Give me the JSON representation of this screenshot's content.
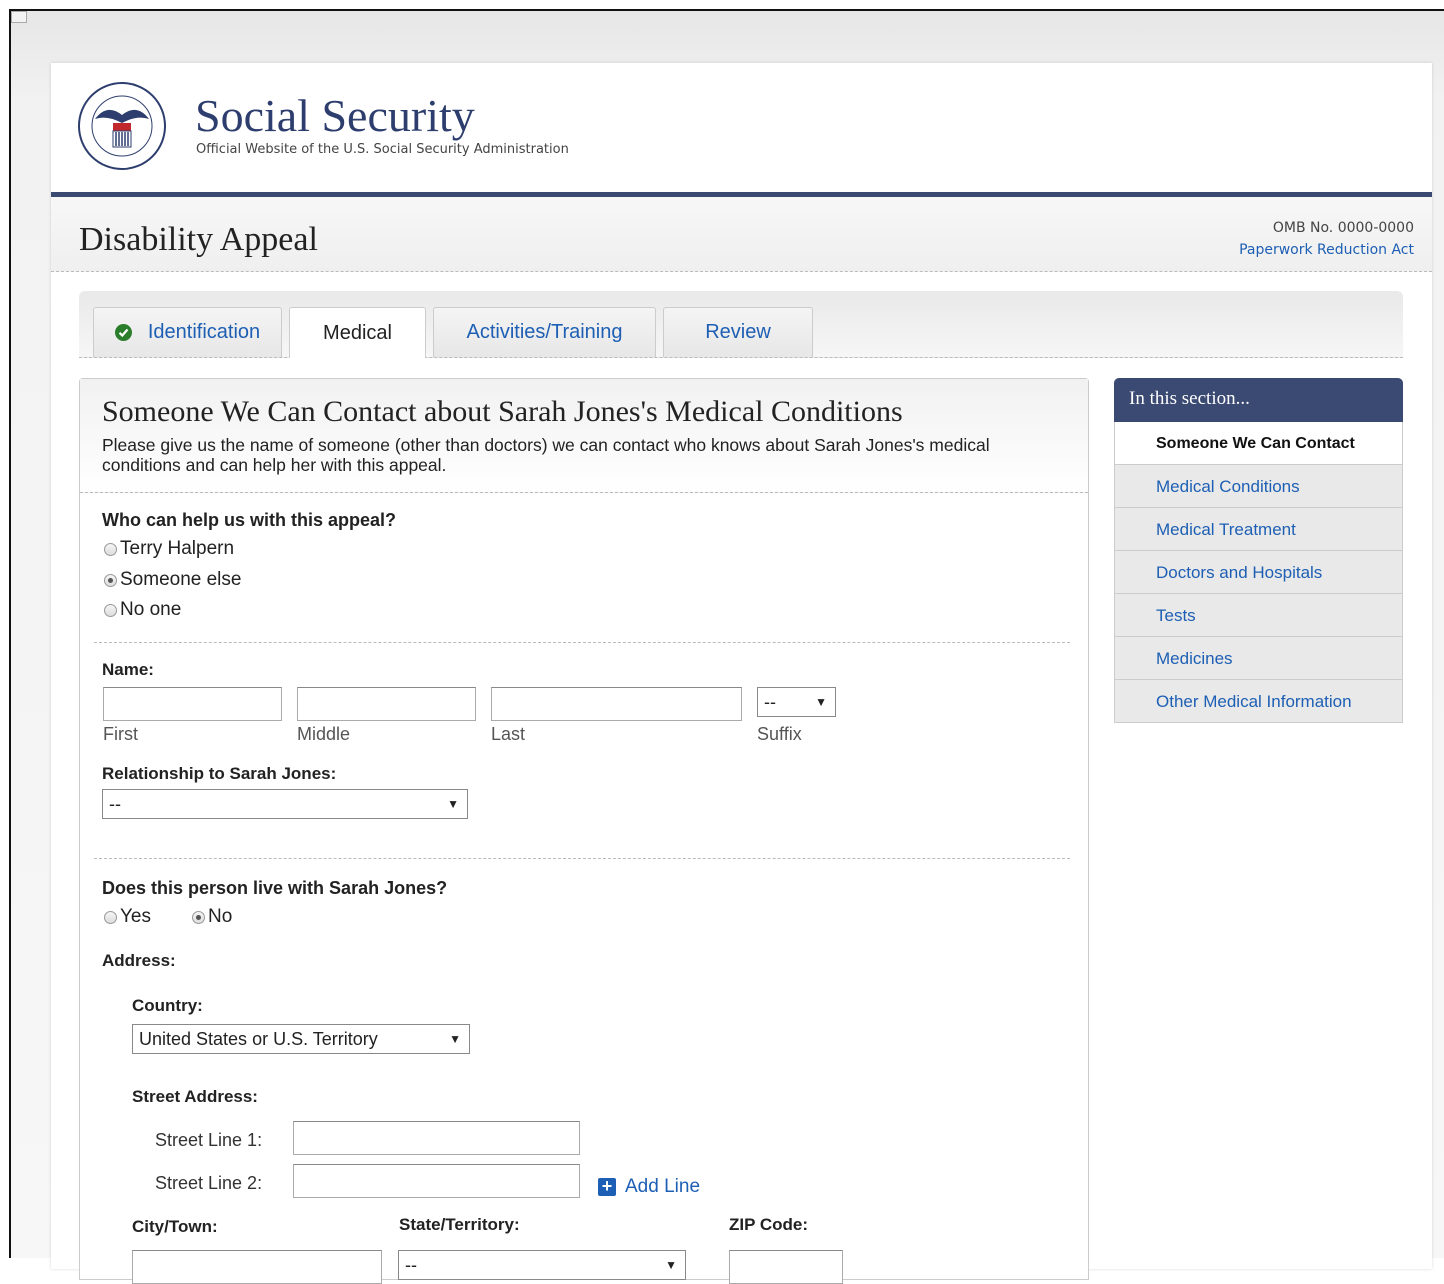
{
  "header": {
    "site_title": "Social Security",
    "site_subtitle": "Official Website of the U.S. Social Security Administration",
    "seal_text": "SOCIAL SECURITY ADMINISTRATION USA"
  },
  "form": {
    "title": "Disability Appeal",
    "omb": "OMB No. 0000-0000",
    "paperwork_link": "Paperwork Reduction Act"
  },
  "tabs": [
    {
      "label": "Identification",
      "completed": true
    },
    {
      "label": "Medical",
      "active": true
    },
    {
      "label": "Activities/Training"
    },
    {
      "label": "Review"
    }
  ],
  "panel": {
    "title": "Someone We Can Contact about Sarah Jones's Medical Conditions",
    "description": "Please give us the name of someone (other than doctors) we can contact who knows about Sarah Jones's medical conditions and can help her with this appeal.",
    "who_question": "Who can help us with this appeal?",
    "who_options": [
      "Terry Halpern",
      "Someone else",
      "No one"
    ],
    "who_selected": "Someone else",
    "name_label": "Name:",
    "name_fields": {
      "first": "First",
      "middle": "Middle",
      "last": "Last",
      "suffix": "Suffix"
    },
    "suffix_value": "--",
    "relationship_label": "Relationship to Sarah Jones:",
    "relationship_value": "--",
    "live_question": "Does this person live with Sarah Jones?",
    "live_options": [
      "Yes",
      "No"
    ],
    "live_selected": "No",
    "address_label": "Address:",
    "country_label": "Country:",
    "country_value": "United States or U.S. Territory",
    "street_label": "Street Address:",
    "street_line1": "Street Line 1:",
    "street_line2": "Street Line 2:",
    "add_line": "Add Line",
    "city_label": "City/Town:",
    "state_label": "State/Territory:",
    "state_value": "--",
    "zip_label": "ZIP Code:"
  },
  "sidebar": {
    "heading": "In this section...",
    "items": [
      {
        "label": "Someone We Can Contact",
        "current": true
      },
      {
        "label": "Medical Conditions"
      },
      {
        "label": "Medical Treatment"
      },
      {
        "label": "Doctors and Hospitals"
      },
      {
        "label": "Tests"
      },
      {
        "label": "Medicines"
      },
      {
        "label": "Other Medical Information"
      }
    ]
  },
  "colors": {
    "navy": "#3b4a73",
    "link": "#1d5fb4",
    "success": "#2a7d2a"
  }
}
